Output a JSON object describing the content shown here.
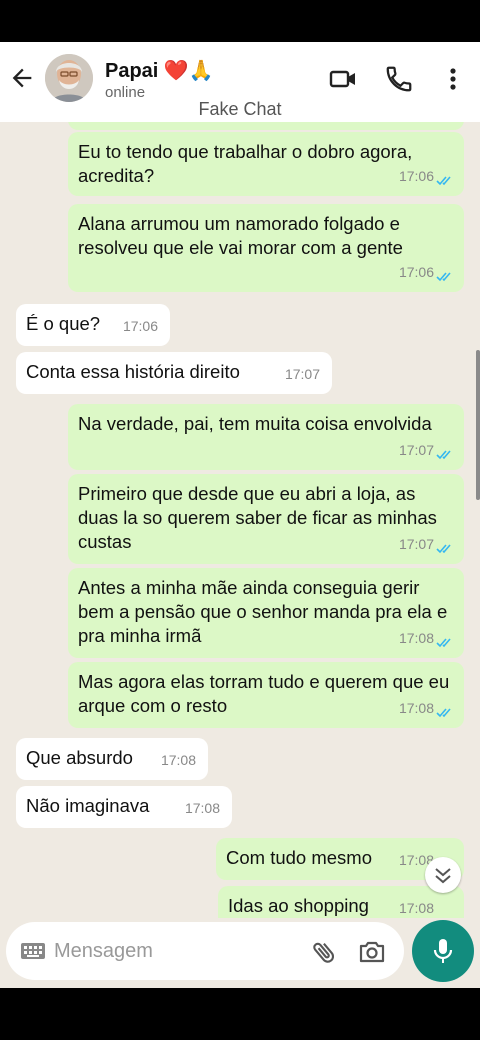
{
  "header": {
    "contact_name": "Papai ❤️🙏",
    "status": "online",
    "overlay_label": "Fake Chat",
    "icons": [
      "back-arrow-icon",
      "video-call-icon",
      "phone-icon",
      "more-options-icon"
    ]
  },
  "messages": [
    {
      "dir": "out",
      "text": "Eu to tendo que trabalhar o dobro agora, acredita?",
      "time": "17:06"
    },
    {
      "dir": "out",
      "text": "Alana arrumou um namorado folgado e resolveu que ele vai morar com a gente",
      "time": "17:06"
    },
    {
      "dir": "in",
      "text": "É o que?",
      "time": "17:06"
    },
    {
      "dir": "in",
      "text": "Conta essa história direito",
      "time": "17:07"
    },
    {
      "dir": "out",
      "text": "Na verdade, pai, tem muita coisa envolvida",
      "time": "17:07"
    },
    {
      "dir": "out",
      "text": "Primeiro que desde que eu abri a loja, as duas la so querem saber de ficar as minhas custas",
      "time": "17:07"
    },
    {
      "dir": "out",
      "text": "Antes a minha mãe ainda conseguia gerir bem a pensão que o senhor manda pra ela e pra minha irmã",
      "time": "17:08"
    },
    {
      "dir": "out",
      "text": "Mas agora elas torram tudo e querem que eu arque com o resto",
      "time": "17:08"
    },
    {
      "dir": "in",
      "text": "Que absurdo",
      "time": "17:08"
    },
    {
      "dir": "in",
      "text": "Não imaginava",
      "time": "17:08"
    },
    {
      "dir": "out",
      "text": "Com tudo mesmo",
      "time": "17:08"
    },
    {
      "dir": "out",
      "text": "Idas ao shopping",
      "time": "17:08"
    }
  ],
  "composer": {
    "placeholder": "Mensagem"
  },
  "colors": {
    "outgoing_bubble": "#dcf8c6",
    "incoming_bubble": "#ffffff",
    "chat_background": "#efeae2",
    "accent": "#128c7e",
    "read_ticks": "#34b7f1"
  }
}
